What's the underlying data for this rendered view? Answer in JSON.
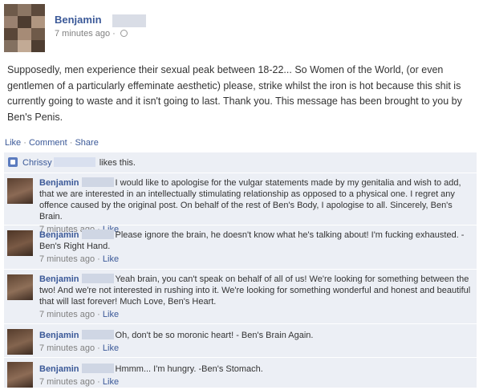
{
  "post": {
    "author": "Benjamin",
    "time": "7 minutes ago",
    "separator": "·",
    "text": "Supposedly, men experience their sexual peak between 18-22... So Women of the World, (or even gentlemen of a particularly effeminate aesthetic) please, strike whilst the iron is hot because this shit is currently going to waste and it isn't going to last. Thank you. This message has been brought to you by Ben's Penis."
  },
  "actions": {
    "like": "Like",
    "dot1": "·",
    "comment": "Comment",
    "dot2": "·",
    "share": "Share"
  },
  "likes": {
    "name": "Chrissy",
    "suffix": "likes this."
  },
  "comments": [
    {
      "author": "Benjamin",
      "text": "I would like to apologise for the vulgar statements made by my genitalia and wish to add, that we are interested in an intellectually stimulating relationship as opposed to a physical one. I regret any offence caused by the original post. On behalf of the rest of Ben's Body, I apologise to all. Sincerely, Ben's Brain.",
      "time": "7 minutes ago",
      "like": "Like"
    },
    {
      "author": "Benjamin",
      "text": "Please ignore the brain, he doesn't know what he's talking about! I'm fucking exhausted. - Ben's Right Hand.",
      "time": "7 minutes ago",
      "like": "Like"
    },
    {
      "author": "Benjamin",
      "text": "Yeah brain, you can't speak on behalf of all of us! We're looking for something between the two! And we're not interested in rushing into it. We're looking for something wonderful and honest and beautiful that will last forever! Much Love, Ben's Heart.",
      "time": "7 minutes ago",
      "like": "Like"
    },
    {
      "author": "Benjamin",
      "text": "Oh, don't be so moronic heart! - Ben's Brain Again.",
      "time": "7 minutes ago",
      "like": "Like"
    },
    {
      "author": "Benjamin",
      "text": "Hmmm... I'm hungry. -Ben's Stomach.",
      "time": "7 minutes ago",
      "like": "Like"
    }
  ],
  "colors": {
    "link": "#3b5998",
    "panel": "#eceff5",
    "meta": "#808080"
  }
}
